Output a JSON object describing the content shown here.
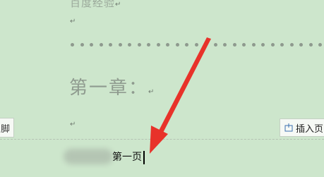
{
  "document": {
    "top_line": "百度经验",
    "paragraph_mark": "↵",
    "chapter_heading": "第一章：",
    "footer_text": "第一页"
  },
  "toolbar": {
    "footer_button_label": "脚",
    "insert_button_label": "插入页"
  },
  "colors": {
    "background": "#cde6cc",
    "arrow": "#e8322a"
  },
  "icons": {
    "insert": "insert-page-icon",
    "annotation": "red-arrow"
  }
}
